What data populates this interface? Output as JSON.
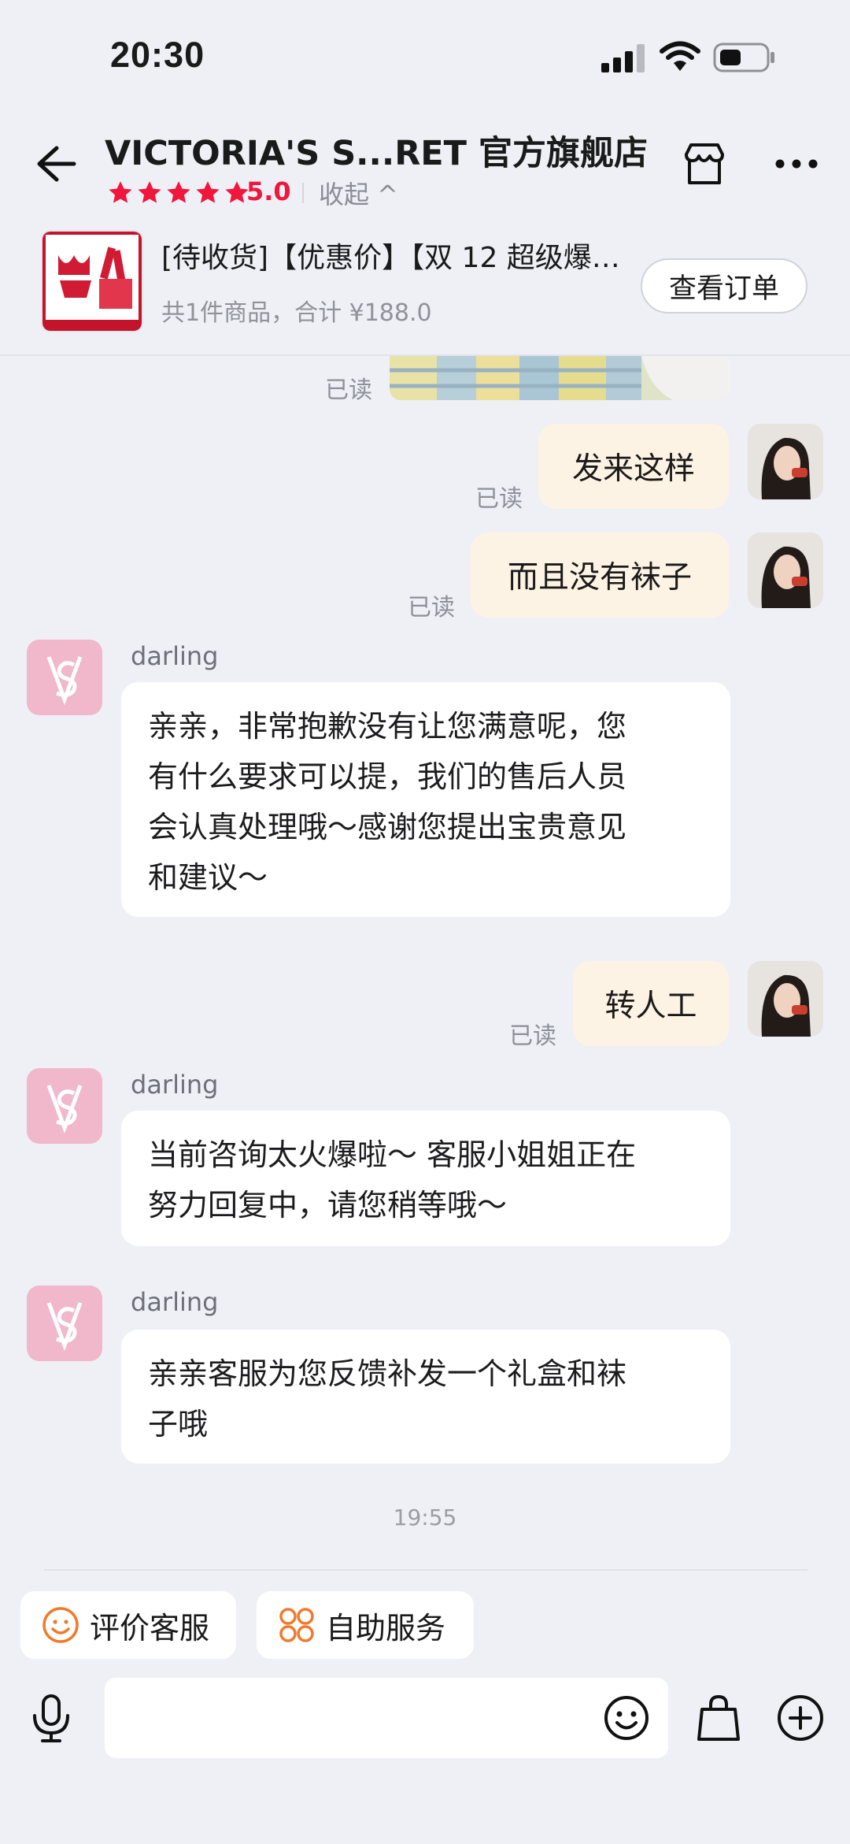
{
  "status_bar": {
    "time": "20:30"
  },
  "header": {
    "title": "VICTORIA'S S...RET 官方旗舰店",
    "rating": "5.0",
    "collapse_label": "收起 ^"
  },
  "order": {
    "title": "[待收货]【优惠价】【双 12 超级爆款】…",
    "summary": "共1件商品，合计 ¥188.0",
    "view_button": "查看订单"
  },
  "messages": [
    {
      "side": "me",
      "kind": "image",
      "status": "已读"
    },
    {
      "side": "me",
      "text": "发来这样",
      "status": "已读"
    },
    {
      "side": "me",
      "text": "而且没有袜子",
      "status": "已读"
    },
    {
      "side": "agent",
      "sender": "darling",
      "lines": [
        "亲亲，非常抱歉没有让您满意呢，您",
        "有什么要求可以提，我们的售后人员",
        "会认真处理哦～感谢您提出宝贵意见",
        "和建议～"
      ]
    },
    {
      "side": "me",
      "text": "转人工",
      "status": "已读"
    },
    {
      "side": "agent",
      "sender": "darling",
      "lines": [
        "当前咨询太火爆啦～ 客服小姐姐正在",
        "努力回复中，请您稍等哦～"
      ]
    },
    {
      "side": "agent",
      "sender": "darling",
      "lines": [
        "亲亲客服为您反馈补发一个礼盒和袜",
        "子哦"
      ]
    }
  ],
  "timestamp": "19:55",
  "quick_actions": {
    "rate": "评价客服",
    "self_service": "自助服务"
  },
  "input": {
    "placeholder": ""
  },
  "colors": {
    "accent_red": "#f0163c",
    "my_bubble": "#fdf3e4",
    "brand_pink": "#f0b8ca",
    "quick_orange": "#f07a2c"
  }
}
